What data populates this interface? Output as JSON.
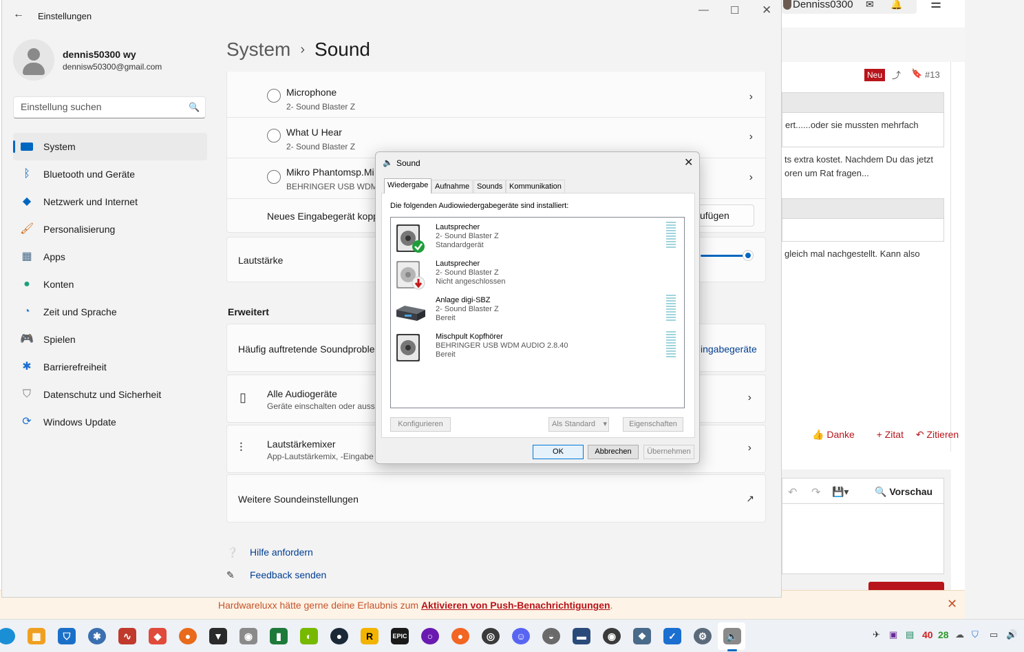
{
  "browser": {
    "username": "Denniss0300",
    "badge_new": "Neu",
    "post_number": "#13",
    "quote_text": "ert......oder sie mussten mehrfach",
    "post_line1": "ts extra kostet. Nachdem Du das jetzt",
    "post_line2": "oren um Rat fragen...",
    "post_line3": "gleich mal nachgestellt. Kann also",
    "actions": [
      "Danke",
      "+ Zitat",
      "Zitieren"
    ],
    "preview_label": "Vorschau",
    "notification": {
      "text_before": "Hardwareluxx hätte gerne deine Erlaubnis zum ",
      "link": "Aktivieren von Push-Benachrichtigungen",
      "text_after": "."
    }
  },
  "settings": {
    "window_title": "Einstellungen",
    "profile": {
      "name": "dennis50300 wy",
      "email": "dennisw50300@gmail.com"
    },
    "search": {
      "placeholder": "Einstellung suchen"
    },
    "nav": [
      {
        "label": "System",
        "icon": "monitor-icon",
        "active": true
      },
      {
        "label": "Bluetooth und Geräte",
        "icon": "bluetooth-icon"
      },
      {
        "label": "Netzwerk und Internet",
        "icon": "wifi-icon"
      },
      {
        "label": "Personalisierung",
        "icon": "brush-icon"
      },
      {
        "label": "Apps",
        "icon": "apps-icon"
      },
      {
        "label": "Konten",
        "icon": "person-icon"
      },
      {
        "label": "Zeit und Sprache",
        "icon": "globe-clock-icon"
      },
      {
        "label": "Spielen",
        "icon": "gamepad-icon"
      },
      {
        "label": "Barrierefreiheit",
        "icon": "accessibility-icon"
      },
      {
        "label": "Datenschutz und Sicherheit",
        "icon": "shield-icon"
      },
      {
        "label": "Windows Update",
        "icon": "update-icon"
      }
    ],
    "breadcrumb": {
      "parent": "System",
      "current": "Sound"
    },
    "inputs": [
      {
        "name": "Microphone",
        "device": "2- Sound Blaster Z"
      },
      {
        "name": "What U Hear",
        "device": "2- Sound Blaster Z"
      },
      {
        "name": "Mikro Phantomsp.Mi",
        "device": "BEHRINGER USB WDM A"
      }
    ],
    "add_input_label": "Neues Eingabegerät kopp",
    "add_button_label": "ufügen",
    "volume_label": "Lautstärke",
    "volume_level": 1.0,
    "advanced_header": "Erweitert",
    "troubleshoot_label": "Häufig auftretende Soundproble",
    "troubleshoot_link": "ingabegeräte",
    "all_devices": {
      "title": "Alle Audiogeräte",
      "sub": "Geräte einschalten oder auss"
    },
    "mixer": {
      "title": "Lautstärkemixer",
      "sub": "App-Lautstärkemix, -Eingabe"
    },
    "more_sound_settings": "Weitere Soundeinstellungen",
    "help": "Hilfe anfordern",
    "feedback": "Feedback senden"
  },
  "dialog": {
    "title": "Sound",
    "tabs": [
      "Wiedergabe",
      "Aufnahme",
      "Sounds",
      "Kommunikation"
    ],
    "intro": "Die folgenden Audiowiedergabegeräte sind installiert:",
    "devices": [
      {
        "name": "Lautsprecher",
        "driver": "2- Sound Blaster Z",
        "status": "Standardgerät",
        "badge": "check",
        "meter": true
      },
      {
        "name": "Lautsprecher",
        "driver": "2- Sound Blaster Z",
        "status": "Nicht angeschlossen",
        "badge": "down",
        "meter": false
      },
      {
        "name": "Anlage digi-SBZ",
        "driver": "2- Sound Blaster Z",
        "status": "Bereit",
        "badge": "none",
        "meter": true
      },
      {
        "name": "Mischpult Kopfhörer",
        "driver": "BEHRINGER USB WDM AUDIO 2.8.40",
        "status": "Bereit",
        "badge": "none",
        "meter": true
      }
    ],
    "buttons": {
      "configure": "Konfigurieren",
      "set_default": "Als Standard",
      "properties": "Eigenschaften",
      "ok": "OK",
      "cancel": "Abbrechen",
      "apply": "Übernehmen"
    }
  },
  "taskbar": {
    "tray_numbers": [
      "40",
      "28"
    ]
  },
  "colors": {
    "accent": "#0067c0",
    "forum_red": "#b8141b",
    "notif_text": "#c5532b"
  }
}
